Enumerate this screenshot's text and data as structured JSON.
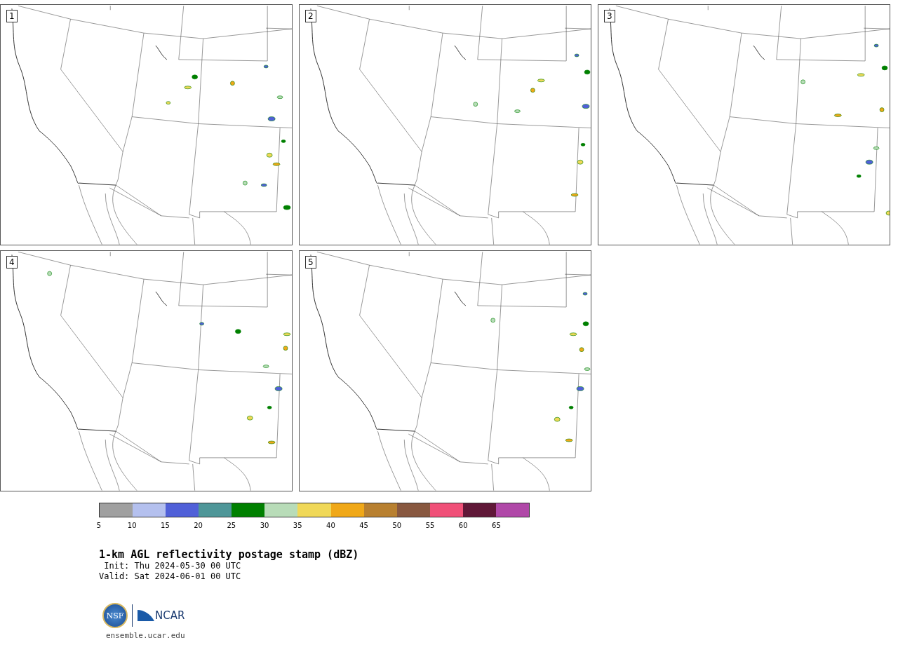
{
  "panels": [
    {
      "label": "1"
    },
    {
      "label": "2"
    },
    {
      "label": "3"
    },
    {
      "label": "4"
    },
    {
      "label": "5"
    }
  ],
  "colorbar": {
    "colors": [
      {
        "color": "#a0a0a0"
      },
      {
        "color": "#b4c0ee"
      },
      {
        "color": "#5060d8"
      },
      {
        "color": "#4e9698"
      },
      {
        "color": "#008000"
      },
      {
        "color": "#b8dcb8"
      },
      {
        "color": "#f0d858"
      },
      {
        "color": "#f0a818"
      },
      {
        "color": "#b88030"
      },
      {
        "color": "#885840"
      },
      {
        "color": "#f05078"
      },
      {
        "color": "#601838"
      },
      {
        "color": "#b048a8"
      }
    ],
    "ticks": [
      "5",
      "10",
      "15",
      "20",
      "25",
      "30",
      "35",
      "40",
      "45",
      "50",
      "55",
      "60",
      "65"
    ]
  },
  "title": "1-km AGL reflectivity postage stamp (dBZ)",
  "init": " Init: Thu 2024-05-30 00 UTC",
  "valid": "Valid: Sat 2024-06-01 00 UTC",
  "logo": {
    "nsf": "NSF",
    "ncar": "NCAR"
  },
  "url": "ensemble.ucar.edu"
}
